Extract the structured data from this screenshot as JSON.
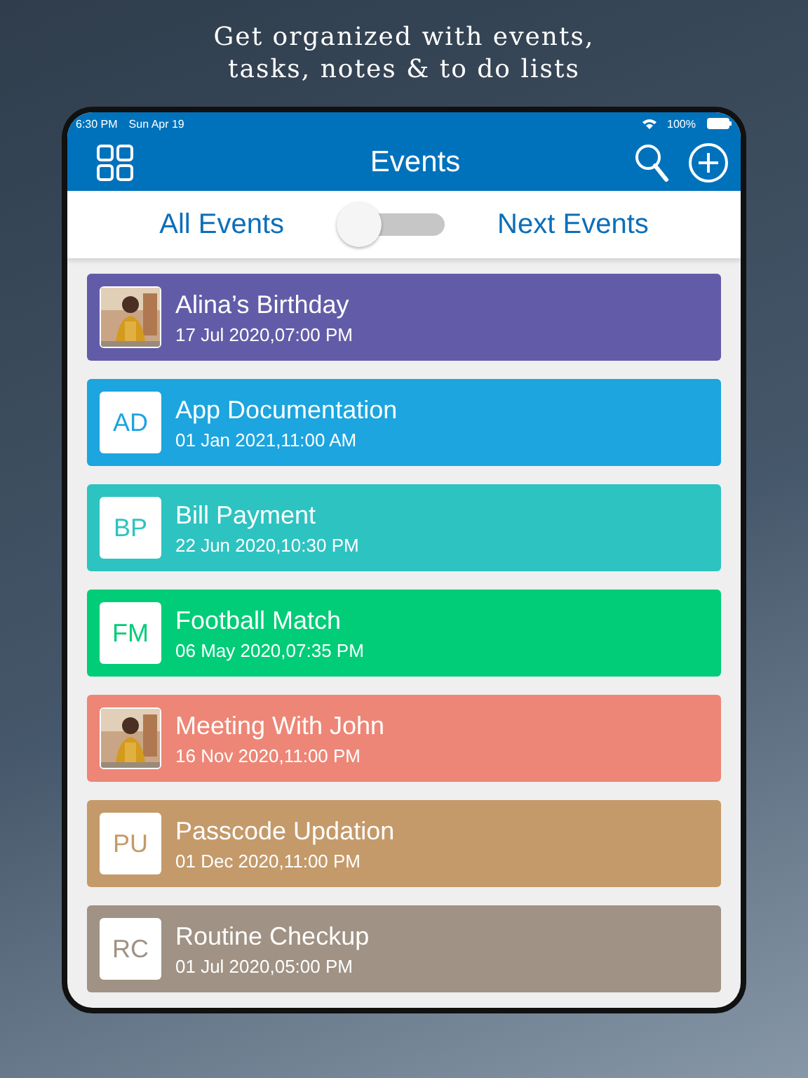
{
  "headline": [
    "Get organized with events,",
    "tasks, notes & to do lists"
  ],
  "status_bar": {
    "time": "6:30 PM",
    "date": "Sun Apr 19",
    "battery": "100%"
  },
  "nav_bar": {
    "title": "Events"
  },
  "filter": {
    "left_label": "All Events",
    "right_label": "Next Events",
    "on": false
  },
  "events": [
    {
      "kind": "picture",
      "title": "Alina’s Birthday",
      "date": "17 Jul 2020,07:00 PM",
      "color": "#625ca8"
    },
    {
      "kind": "initials",
      "initials": "AD",
      "title": "App Documentation",
      "date": "01 Jan 2021,11:00 AM",
      "color": "#1ca5df"
    },
    {
      "kind": "initials",
      "initials": "BP",
      "title": "Bill Payment",
      "date": "22 Jun 2020,10:30 PM",
      "color": "#2dc3c1"
    },
    {
      "kind": "initials",
      "initials": "FM",
      "title": "Football Match",
      "date": "06 May 2020,07:35 PM",
      "color": "#01cc78"
    },
    {
      "kind": "picture",
      "title": "Meeting With John",
      "date": "16 Nov 2020,11:00 PM",
      "color": "#ed8676"
    },
    {
      "kind": "initials",
      "initials": "PU",
      "title": "Passcode Updation",
      "date": "01 Dec 2020,11:00 PM",
      "color": "#c49a6a"
    },
    {
      "kind": "initials",
      "initials": "RC",
      "title": "Routine Checkup",
      "date": "01 Jul 2020,05:00 PM",
      "color": "#a09284"
    }
  ]
}
